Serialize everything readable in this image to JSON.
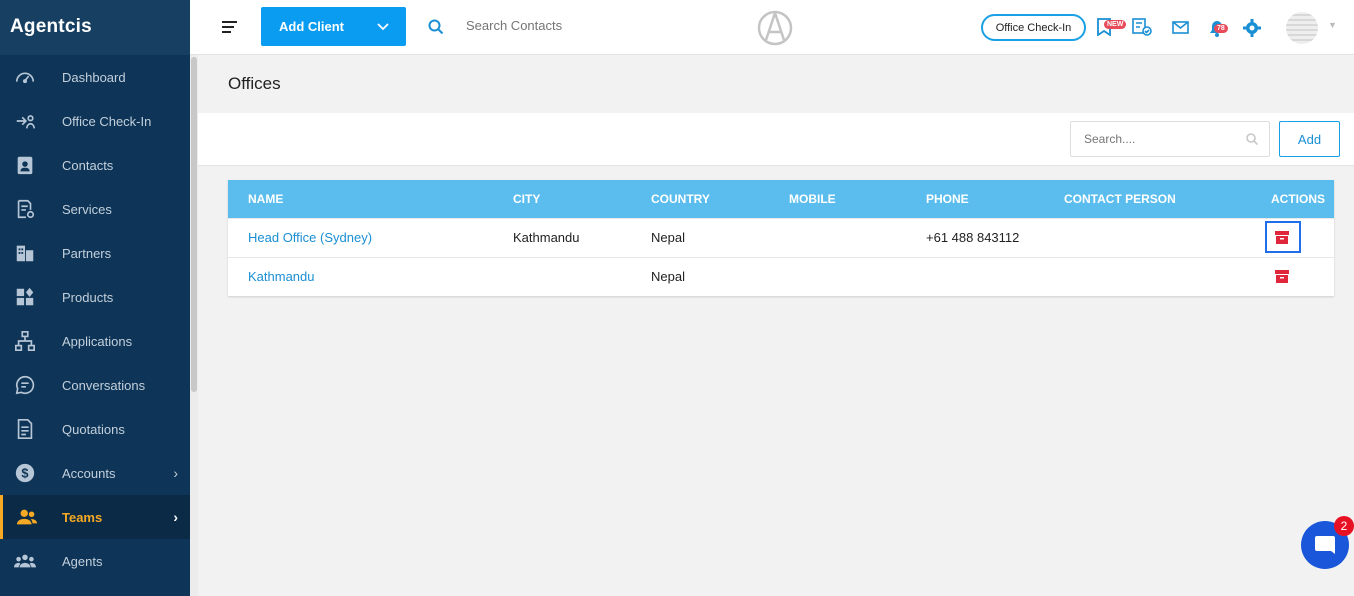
{
  "brand": "Agentcis",
  "sidebar": {
    "items": [
      {
        "label": "Dashboard",
        "icon": "dashboard-icon"
      },
      {
        "label": "Office Check-In",
        "icon": "check-in-icon"
      },
      {
        "label": "Contacts",
        "icon": "contacts-icon"
      },
      {
        "label": "Services",
        "icon": "services-icon"
      },
      {
        "label": "Partners",
        "icon": "partners-icon"
      },
      {
        "label": "Products",
        "icon": "products-icon"
      },
      {
        "label": "Applications",
        "icon": "applications-icon"
      },
      {
        "label": "Conversations",
        "icon": "conversations-icon"
      },
      {
        "label": "Quotations",
        "icon": "quotations-icon"
      },
      {
        "label": "Accounts",
        "icon": "accounts-icon",
        "arrow": "›"
      },
      {
        "label": "Teams",
        "icon": "teams-icon",
        "arrow": "›",
        "active": true
      },
      {
        "label": "Agents",
        "icon": "agents-icon"
      }
    ]
  },
  "topbar": {
    "add_client": "Add Client",
    "search_placeholder": "Search Contacts",
    "checkin_label": "Office Check-In",
    "new_badge": "NEW",
    "notification_count": "78"
  },
  "page": {
    "title": "Offices",
    "search_placeholder": "Search....",
    "add_label": "Add"
  },
  "table": {
    "headers": {
      "name": "NAME",
      "city": "CITY",
      "country": "COUNTRY",
      "mobile": "MOBILE",
      "phone": "PHONE",
      "contact": "CONTACT PERSON",
      "actions": "ACTIONS"
    },
    "rows": [
      {
        "name": "Head Office (Sydney)",
        "city": "Kathmandu",
        "country": "Nepal",
        "mobile": "",
        "phone": "+61 488 843112",
        "contact": ""
      },
      {
        "name": "Kathmandu",
        "city": "",
        "country": "Nepal",
        "mobile": "",
        "phone": "",
        "contact": ""
      }
    ]
  },
  "chat": {
    "badge_count": "2"
  },
  "colors": {
    "sidebar_bg": "#0e3557",
    "accent_blue": "#0a9cf0",
    "table_header": "#5bbdee",
    "active_orange": "#f6a924",
    "delete_red": "#e0263a"
  }
}
